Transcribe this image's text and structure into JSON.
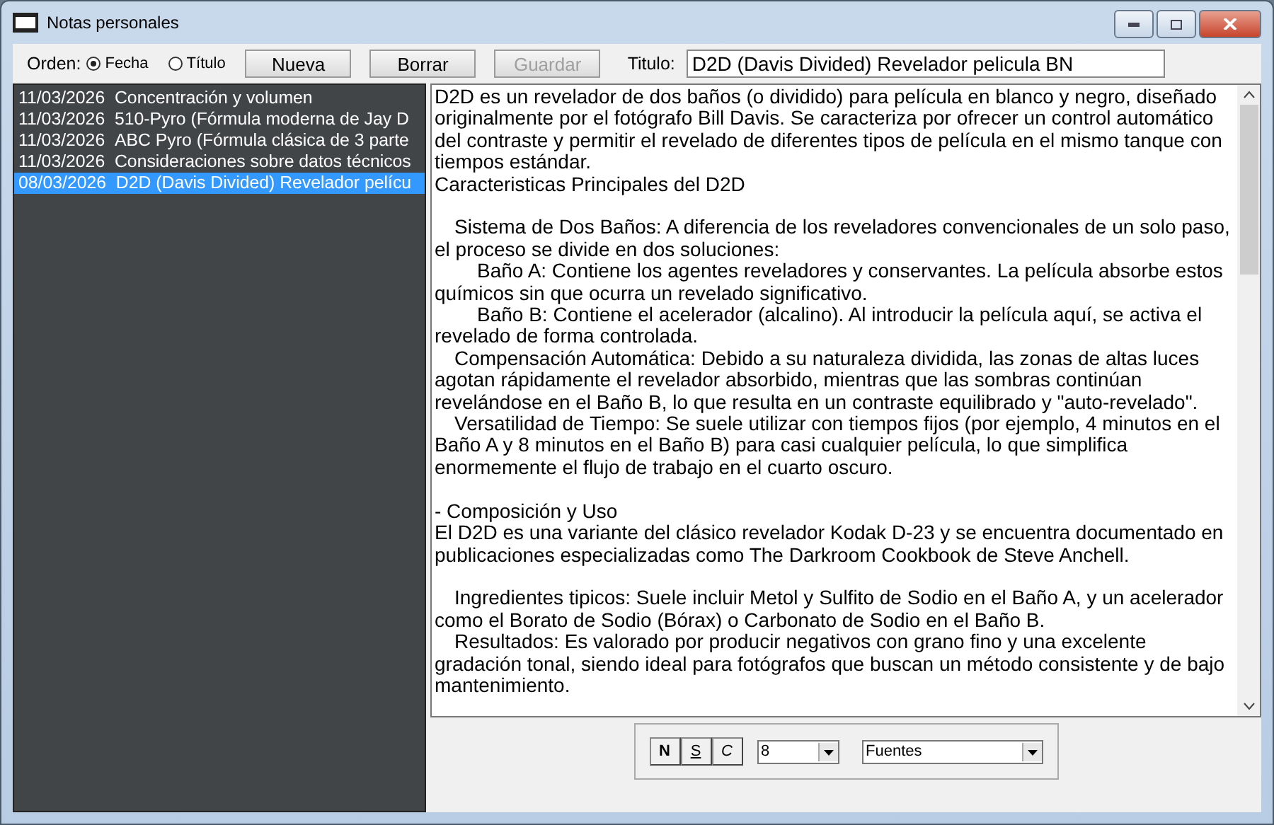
{
  "window": {
    "title": "Notas personales"
  },
  "toolbar": {
    "order_label": "Orden:",
    "order_options": [
      {
        "label": "Fecha",
        "selected": true
      },
      {
        "label": "Título",
        "selected": false
      }
    ],
    "buttons": [
      {
        "label": "Nueva",
        "disabled": false
      },
      {
        "label": "Borrar",
        "disabled": false
      },
      {
        "label": "Guardar",
        "disabled": true
      }
    ],
    "title_label": "Titulo:",
    "title_value": "D2D (Davis Divided) Revelador pelicula BN"
  },
  "notes": [
    {
      "date": "11/03/2026",
      "title": "Concentración y volumen",
      "selected": false
    },
    {
      "date": "11/03/2026",
      "title": "510-Pyro (Fórmula moderna de Jay D",
      "selected": false
    },
    {
      "date": "11/03/2026",
      "title": "ABC Pyro (Fórmula clásica de 3 parte",
      "selected": false
    },
    {
      "date": "11/03/2026",
      "title": "Consideraciones sobre datos técnicos",
      "selected": false
    },
    {
      "date": "08/03/2026",
      "title": "D2D (Davis Divided) Revelador pelícu",
      "selected": true
    }
  ],
  "body": [
    {
      "kind": "text",
      "space_before": false,
      "text": "D2D es un revelador de dos baños (o dividido) para película en blanco y negro, diseñado originalmente por el fotógrafo Bill Davis. Se caracteriza por ofrecer un control automático del contraste y permitir el revelado de diferentes tipos de película en el mismo tanque con tiempos estándar."
    },
    {
      "kind": "text",
      "space_before": false,
      "text": "Caracteristicas Principales del D2D"
    },
    {
      "kind": "item",
      "space_before": true,
      "text": "Sistema de Dos Baños: A diferencia de los reveladores convencionales de un solo paso, el proceso se divide en dos soluciones:"
    },
    {
      "kind": "subitem",
      "space_before": false,
      "text": "Baño A: Contiene los agentes reveladores y conservantes. La película absorbe estos químicos sin que ocurra un revelado significativo."
    },
    {
      "kind": "subitem",
      "space_before": false,
      "text": "Baño B: Contiene el acelerador (alcalino). Al introducir la película aquí, se activa el revelado de forma controlada."
    },
    {
      "kind": "item",
      "space_before": false,
      "text": "Compensación Automática: Debido a su naturaleza dividida, las zonas de altas luces agotan rápidamente el revelador absorbido, mientras que las sombras continúan revelándose en el Baño B, lo que resulta en un contraste equilibrado y \"auto-revelado\"."
    },
    {
      "kind": "item",
      "space_before": false,
      "text": "Versatilidad de Tiempo: Se suele utilizar con tiempos fijos (por ejemplo, 4 minutos en el Baño A y 8 minutos en el Baño B) para casi cualquier película, lo que simplifica enormemente el flujo de trabajo en el cuarto oscuro."
    },
    {
      "kind": "text",
      "space_before": true,
      "text": "- Composición y Uso"
    },
    {
      "kind": "text",
      "space_before": false,
      "text": "El D2D es una variante del clásico revelador Kodak D-23 y se encuentra documentado en publicaciones especializadas como The Darkroom Cookbook de Steve Anchell."
    },
    {
      "kind": "item",
      "space_before": true,
      "text": "Ingredientes tipicos: Suele incluir Metol y Sulfito de Sodio en el Baño A, y un acelerador como el Borato de Sodio (Bórax) o Carbonato de Sodio en el Baño B."
    },
    {
      "kind": "item",
      "space_before": false,
      "text": "Resultados: Es valorado por producir negativos con grano fino y una excelente gradación tonal, siendo ideal para fotógrafos que buscan un método consistente y de bajo mantenimiento."
    }
  ],
  "format_bar": {
    "style_buttons": [
      {
        "label": "N",
        "kind": "bold"
      },
      {
        "label": "S",
        "kind": "underline"
      },
      {
        "label": "C",
        "kind": "italic"
      }
    ],
    "size": "8",
    "font": "Fuentes"
  }
}
